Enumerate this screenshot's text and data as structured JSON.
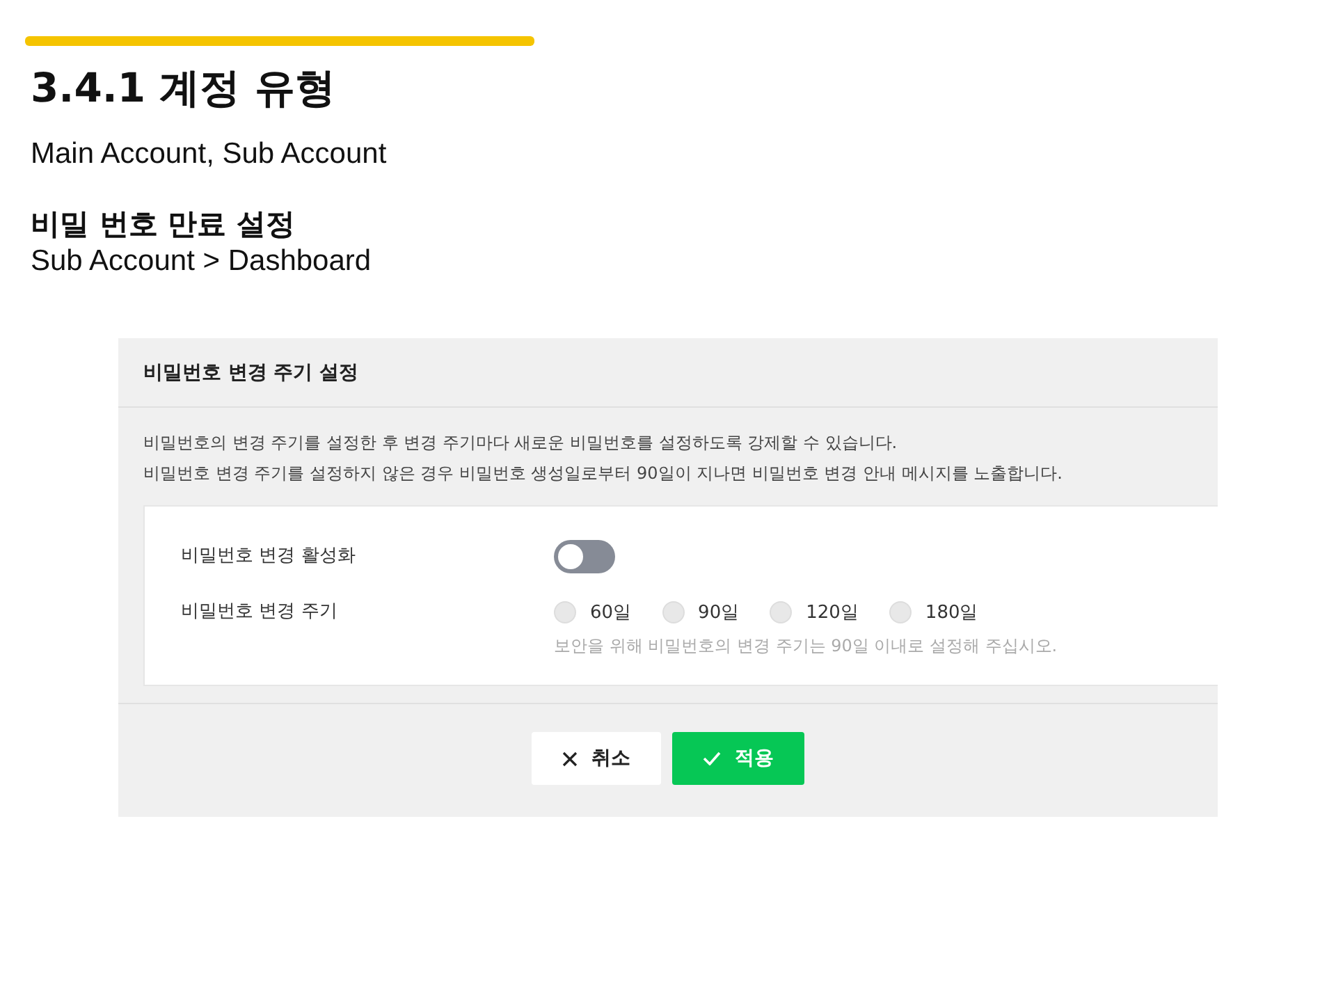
{
  "slide": {
    "title": "3.4.1 계정 유형",
    "subtitle": "Main Account, Sub Account",
    "section_heading": "비밀 번호 만료 설정",
    "breadcrumb": "Sub Account > Dashboard"
  },
  "panel": {
    "title": "비밀번호 변경 주기 설정",
    "description": [
      "비밀번호의 변경 주기를 설정한 후 변경 주기마다 새로운 비밀번호를 설정하도록 강제할 수 있습니다.",
      "비밀번호 변경 주기를 설정하지 않은 경우 비밀번호 생성일로부터 90일이 지나면 비밀번호 변경 안내 메시지를 노출합니다."
    ],
    "toggle": {
      "label": "비밀번호 변경 활성화",
      "on": false
    },
    "cycle": {
      "label": "비밀번호 변경 주기",
      "options": [
        {
          "label": "60일",
          "selected": false
        },
        {
          "label": "90일",
          "selected": false
        },
        {
          "label": "120일",
          "selected": false
        },
        {
          "label": "180일",
          "selected": false
        }
      ],
      "hint": "보안을 위해 비밀번호의 변경 주기는 90일 이내로 설정해 주십시오."
    },
    "buttons": [
      {
        "kind": "cancel",
        "label": "취소"
      },
      {
        "kind": "apply",
        "label": "적용"
      }
    ]
  }
}
